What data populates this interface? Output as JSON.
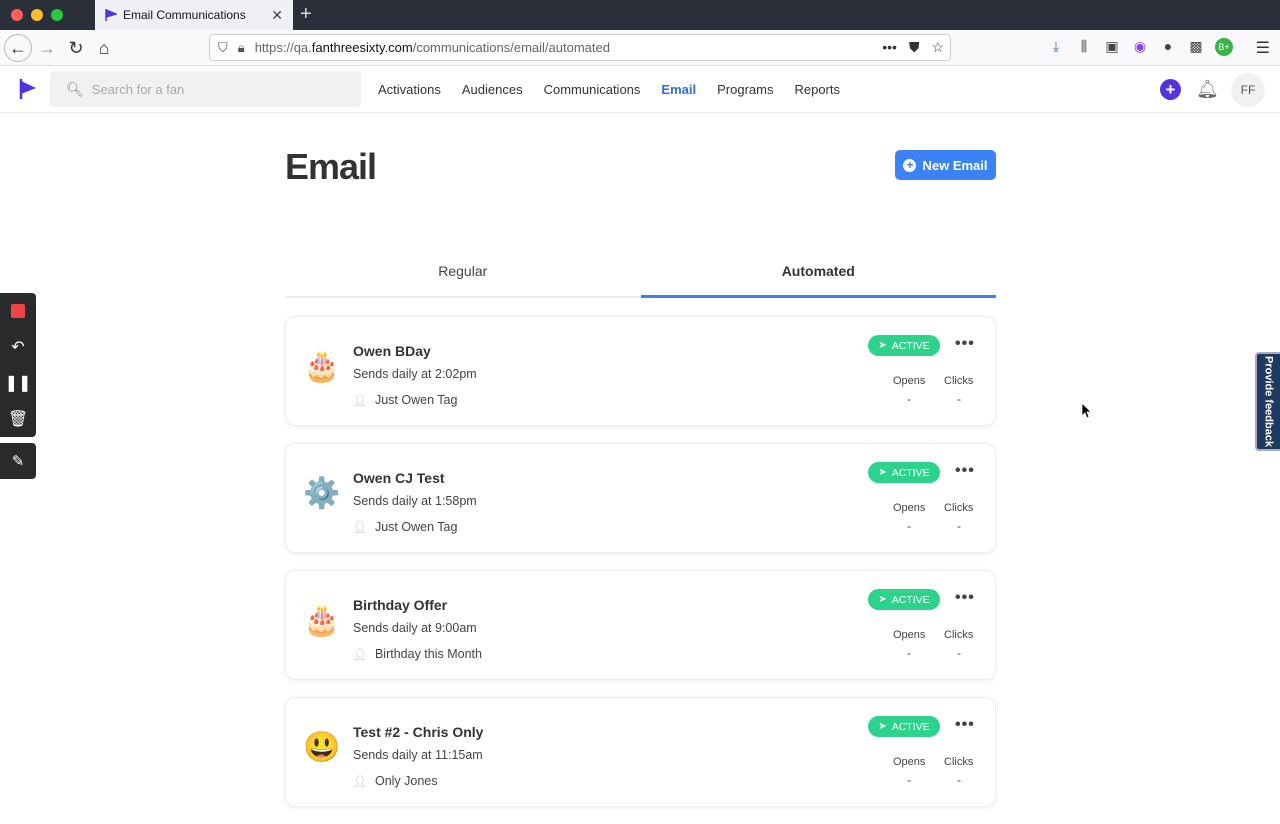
{
  "browser": {
    "tab_title": "Email Communications",
    "url_prefix": "https://qa.",
    "url_domain": "fanthreesixty.com",
    "url_path": "/communications/email/automated"
  },
  "header": {
    "search_placeholder": "Search for a fan",
    "nav": [
      "Activations",
      "Audiences",
      "Communications",
      "Email",
      "Programs",
      "Reports"
    ],
    "active_nav": "Email",
    "avatar_initials": "FF"
  },
  "page": {
    "title": "Email",
    "new_email_label": "New Email",
    "tabs": [
      "Regular",
      "Automated"
    ],
    "active_tab": "Automated"
  },
  "cards": [
    {
      "emoji": "🎂",
      "title": "Owen BDay",
      "schedule": "Sends daily at 2:02pm",
      "audience": "Just Owen Tag",
      "status": "ACTIVE",
      "opens_label": "Opens",
      "clicks_label": "Clicks",
      "opens": "-",
      "clicks": "-"
    },
    {
      "emoji": "⚙️",
      "title": "Owen CJ Test",
      "schedule": "Sends daily at 1:58pm",
      "audience": "Just Owen Tag",
      "status": "ACTIVE",
      "opens_label": "Opens",
      "clicks_label": "Clicks",
      "opens": "-",
      "clicks": "-"
    },
    {
      "emoji": "🎂",
      "title": "Birthday Offer",
      "schedule": "Sends daily at 9:00am",
      "audience": "Birthday this Month",
      "status": "ACTIVE",
      "opens_label": "Opens",
      "clicks_label": "Clicks",
      "opens": "-",
      "clicks": "-"
    },
    {
      "emoji": "😃",
      "title": "Test #2 - Chris Only",
      "schedule": "Sends daily at 11:15am",
      "audience": "Only Jones",
      "status": "ACTIVE",
      "opens_label": "Opens",
      "clicks_label": "Clicks",
      "opens": "-",
      "clicks": "-"
    }
  ],
  "feedback_label": "Provide feedback",
  "colors": {
    "brand": "#5233e2",
    "primary": "#3b82f6",
    "active_badge": "#2bd48a",
    "nav_active": "#2a6fd8"
  }
}
